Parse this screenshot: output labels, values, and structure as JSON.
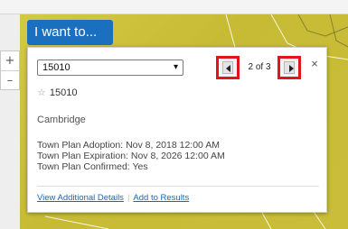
{
  "toolbar": {
    "i_want_to_label": "I want to..."
  },
  "map_controls": {
    "zoom_in_label": "+",
    "zoom_out_label": "–"
  },
  "popup": {
    "selected_feature": "15010",
    "select_caret": "▾",
    "pager": {
      "label": "2 of 3",
      "current": 2,
      "total": 3
    },
    "close_label": "×",
    "favorite": {
      "star": "☆",
      "label": "15010"
    },
    "town": "Cambridge",
    "fields": {
      "adoption": "Town Plan Adoption: Nov 8, 2018 12:00 AM",
      "expiration": "Town Plan Expiration: Nov 8, 2026 12:00 AM",
      "confirmed": "Town Plan Confirmed: Yes"
    },
    "links": {
      "view_details": "View Additional Details",
      "separator": "|",
      "add_to_results": "Add to Results"
    }
  },
  "colors": {
    "map_background": "#c9bf3a",
    "button_blue": "#1a6fbf",
    "highlight_red": "#e0141d",
    "link_blue": "#1a66b8"
  }
}
